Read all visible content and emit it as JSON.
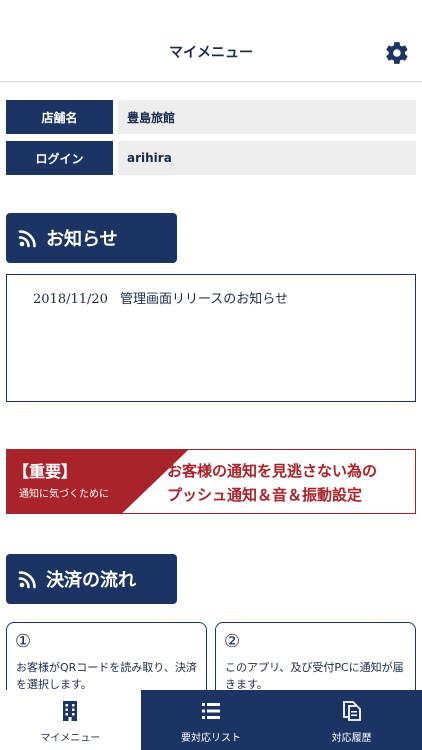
{
  "header": {
    "title": "マイメニュー",
    "settings_icon": "gear-icon"
  },
  "info": [
    {
      "label": "店舗名",
      "value": "豊島旅館"
    },
    {
      "label": "ログイン",
      "value": "arihira"
    }
  ],
  "notice": {
    "heading": "お知らせ",
    "icon": "rss-icon",
    "items": [
      {
        "date": "2018/11/20",
        "text": "管理画面リリースのお知らせ"
      }
    ]
  },
  "banner": {
    "tag": "【重要】",
    "tag_sub": "通知に気づくために",
    "line1": "お客様の通知を見逃さない為の",
    "line2": "プッシュ通知＆音＆振動設定"
  },
  "payment_flow": {
    "heading": "決済の流れ",
    "icon": "rss-icon",
    "steps": [
      {
        "num": "①",
        "text": "お客様がQRコードを読み取り、決済を選択します。"
      },
      {
        "num": "②",
        "text": "このアプリ、及び受付PCに通知が届きます。"
      }
    ]
  },
  "tabs": [
    {
      "label": "マイメニュー",
      "icon": "building-icon",
      "active": true
    },
    {
      "label": "要対応リスト",
      "icon": "list-icon",
      "active": false
    },
    {
      "label": "対応履歴",
      "icon": "documents-icon",
      "active": false
    }
  ],
  "colors": {
    "navy": "#1b3463",
    "red": "#a8232a",
    "value_bg": "#ededed"
  }
}
